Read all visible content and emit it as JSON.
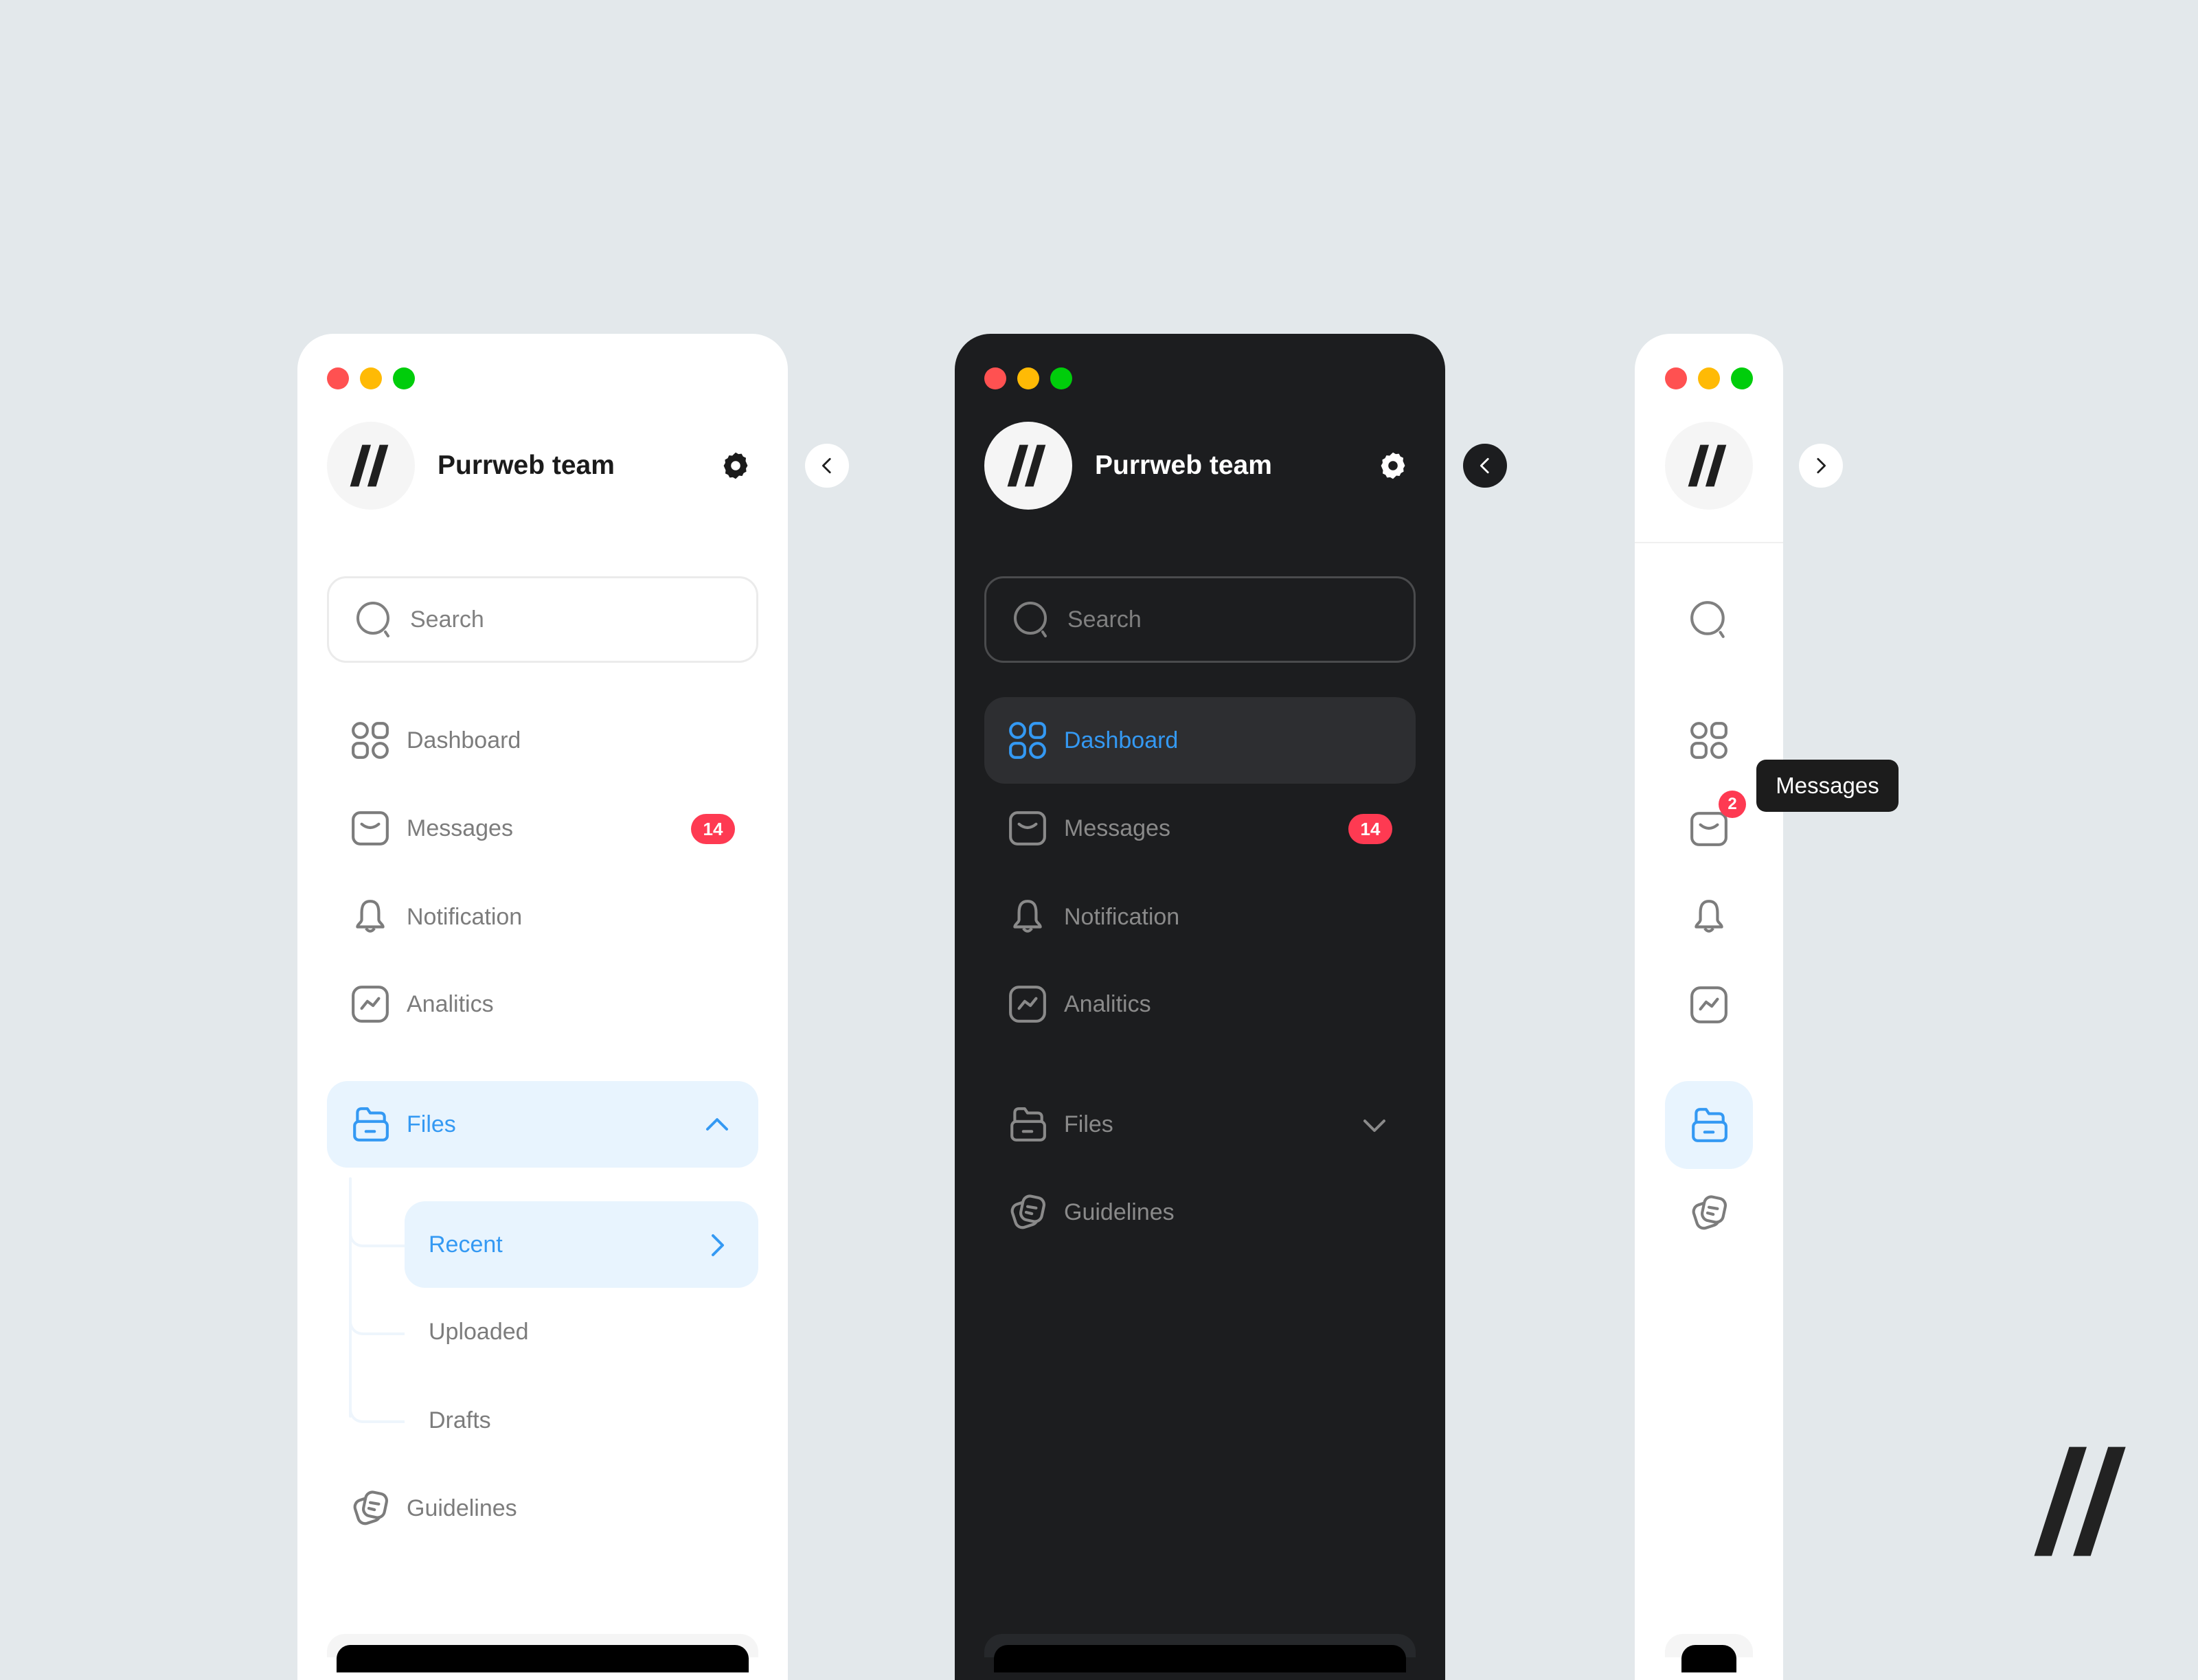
{
  "colors": {
    "background": "#e3e8eb",
    "accent": "#3499f3",
    "badge": "#fe3a52",
    "traffic_red": "#ff5151",
    "traffic_yellow": "#ffba05",
    "traffic_green": "#00cd0b"
  },
  "panels": {
    "light_expanded": {
      "team_name": "Purrweb team",
      "search_placeholder": "Search",
      "nav": [
        {
          "label": "Dashboard",
          "icon": "dashboard-icon"
        },
        {
          "label": "Messages",
          "icon": "mail-icon",
          "badge": "14"
        },
        {
          "label": "Notification",
          "icon": "bell-icon"
        },
        {
          "label": "Analitics",
          "icon": "analytics-icon"
        },
        {
          "label": "Files",
          "icon": "folder-icon",
          "expanded": true,
          "active": true
        },
        {
          "label": "Guidelines",
          "icon": "guidelines-icon"
        }
      ],
      "files_sub": [
        {
          "label": "Recent",
          "active": true
        },
        {
          "label": "Uploaded"
        },
        {
          "label": "Drafts"
        }
      ],
      "collapse_button": "chevron-left-icon"
    },
    "dark_expanded": {
      "team_name": "Purrweb team",
      "search_placeholder": "Search",
      "nav": [
        {
          "label": "Dashboard",
          "icon": "dashboard-icon",
          "active": true
        },
        {
          "label": "Messages",
          "icon": "mail-icon",
          "badge": "14"
        },
        {
          "label": "Notification",
          "icon": "bell-icon"
        },
        {
          "label": "Analitics",
          "icon": "analytics-icon"
        },
        {
          "label": "Files",
          "icon": "folder-icon",
          "expanded": false
        },
        {
          "label": "Guidelines",
          "icon": "guidelines-icon"
        }
      ],
      "collapse_button": "chevron-left-icon"
    },
    "light_collapsed": {
      "nav": [
        {
          "icon": "search-icon"
        },
        {
          "icon": "dashboard-icon"
        },
        {
          "icon": "mail-icon",
          "badge": "2"
        },
        {
          "icon": "bell-icon"
        },
        {
          "icon": "analytics-icon"
        },
        {
          "icon": "folder-icon",
          "active": true
        },
        {
          "icon": "guidelines-icon"
        }
      ],
      "tooltip": "Messages",
      "expand_button": "chevron-right-icon"
    }
  }
}
